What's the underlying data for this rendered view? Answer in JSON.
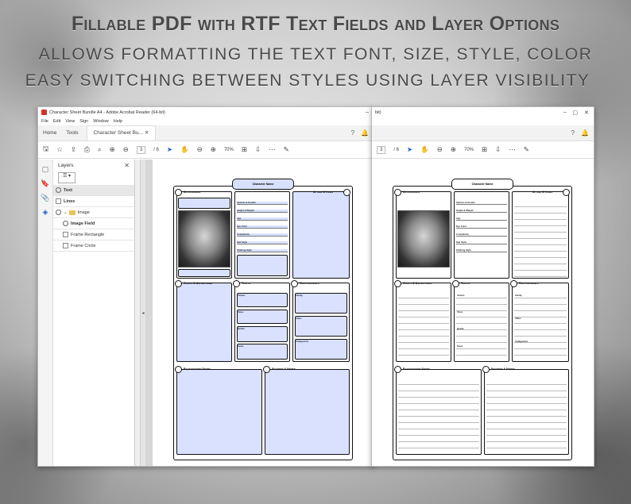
{
  "heading": {
    "line1": "Fillable PDF with RTF Text Fields and Layer Options",
    "line2": "ALLOWS FORMATTING THE TEXT FONT, SIZE, STYLE, COLOR",
    "line3": "EASY SWITCHING BETWEEN STYLES USING LAYER VISIBILITY"
  },
  "window1": {
    "title": "Character Sheet Bundle A4 - Adobe Acrobat Reader (64-bit)",
    "menu": [
      "File",
      "Edit",
      "View",
      "Sign",
      "Window",
      "Help"
    ],
    "tabs": {
      "home": "Home",
      "tools": "Tools",
      "document": "Character Sheet Bu..."
    },
    "toolbar": {
      "page": "3",
      "pages": "/ 6",
      "zoom": "70%"
    },
    "layers_panel": {
      "title": "Layers",
      "items": [
        {
          "label": "Text",
          "visible": true,
          "selected": true
        },
        {
          "label": "Lines",
          "visible": false
        },
        {
          "label": "Image",
          "visible": true,
          "folder": true
        },
        {
          "label": "Image Field",
          "visible": true
        },
        {
          "label": "Frame Rectangle",
          "visible": false
        },
        {
          "label": "Frame Circle",
          "visible": false
        }
      ]
    }
  },
  "window2": {
    "title": "bit)",
    "toolbar": {
      "page": "3",
      "pages": "/ 6",
      "zoom": "70%"
    }
  },
  "sheet": {
    "name_tab": "Character Name",
    "appearance": "Appearance",
    "attire": "Attire & Items",
    "goals": "Goals & Aspirations",
    "traits": "Traits",
    "relationships": "Relationships",
    "background": "Background Story",
    "secrets": "Secrets & Notes",
    "appearance_fields": [
      "Species & Gender",
      "Height & Weight",
      "Age",
      "Eye Color",
      "Complexion",
      "Hair Style",
      "Clothing Style"
    ],
    "traits_fields": [
      "Virtues",
      "Vices",
      "Quirks",
      "Fears"
    ],
    "relationship_fields": [
      "Family",
      "Allies",
      "Antagonists"
    ]
  }
}
